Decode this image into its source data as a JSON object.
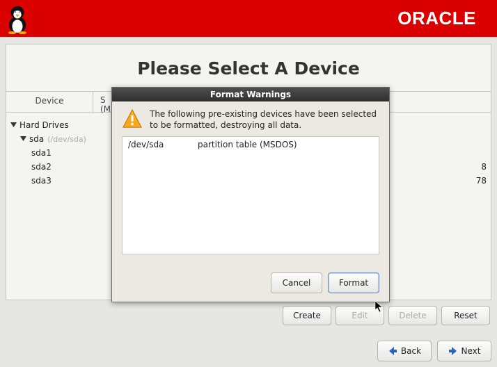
{
  "brand": {
    "logo_text": "ORACLE"
  },
  "page": {
    "title": "Please Select A Device"
  },
  "tree": {
    "col_device": "Device",
    "col_size_abbrev": "S\n(M",
    "root_label": "Hard Drives",
    "disk": {
      "name": "sda",
      "path": "(/dev/sda)"
    },
    "parts": [
      {
        "name": "sda1",
        "size": ""
      },
      {
        "name": "sda2",
        "size": "8"
      },
      {
        "name": "sda3",
        "size": "78"
      }
    ]
  },
  "actions": {
    "create": "Create",
    "edit": "Edit",
    "delete": "Delete",
    "reset": "Reset"
  },
  "nav": {
    "back": "Back",
    "next": "Next"
  },
  "dialog": {
    "title": "Format Warnings",
    "message": "The following pre-existing devices have been selected to be formatted, destroying all data.",
    "rows": [
      {
        "dev": "/dev/sda",
        "desc": "partition table (MSDOS)"
      }
    ],
    "cancel": "Cancel",
    "format": "Format"
  }
}
